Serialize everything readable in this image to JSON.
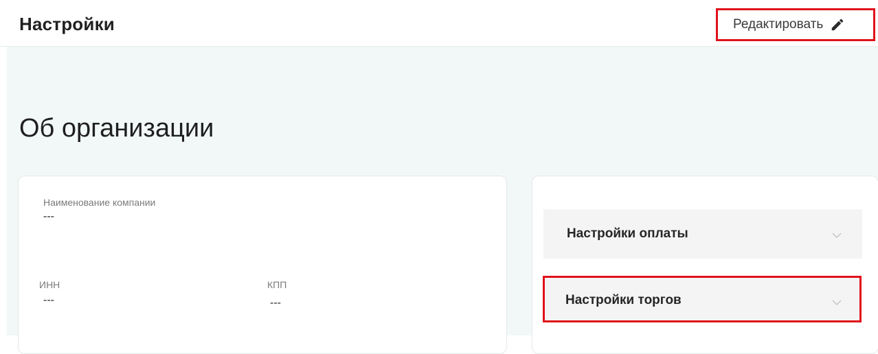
{
  "header": {
    "title": "Настройки",
    "edit_label": "Редактировать",
    "edit_icon": "pencil-icon"
  },
  "section": {
    "title": "Об организации"
  },
  "company": {
    "name_label": "Наименование компании",
    "name_value": "---",
    "inn_label": "ИНН",
    "inn_value": "---",
    "kpp_label": "КПП",
    "kpp_value": "---"
  },
  "settings": {
    "items": [
      {
        "label": "Настройки оплаты",
        "icon": "chevron-down-icon"
      },
      {
        "label": "Настройки торгов",
        "icon": "chevron-down-icon"
      }
    ]
  },
  "colors": {
    "highlight": "#e0101a",
    "background": "#f1f8f7"
  }
}
